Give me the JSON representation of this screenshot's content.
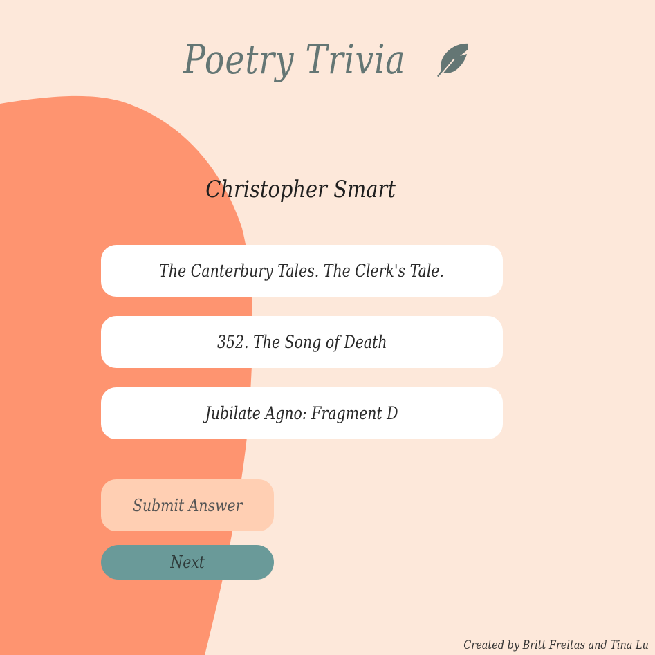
{
  "app": {
    "title": "Poetry Trivia",
    "logo_icon": "feather-icon"
  },
  "quiz": {
    "question": "Christopher Smart",
    "options": [
      "The Canterbury Tales. The Clerk's Tale.",
      "352. The Song of Death",
      "Jubilate Agno: Fragment D"
    ],
    "submit_label": "Submit Answer",
    "next_label": "Next"
  },
  "footer": {
    "credit": "Created by Britt Freitas and Tina Lu"
  },
  "colors": {
    "background": "#fde8da",
    "blob": "#fe9470",
    "title": "#647674",
    "submit_button": "#ffcfb3",
    "next_button": "#6a9a99"
  }
}
